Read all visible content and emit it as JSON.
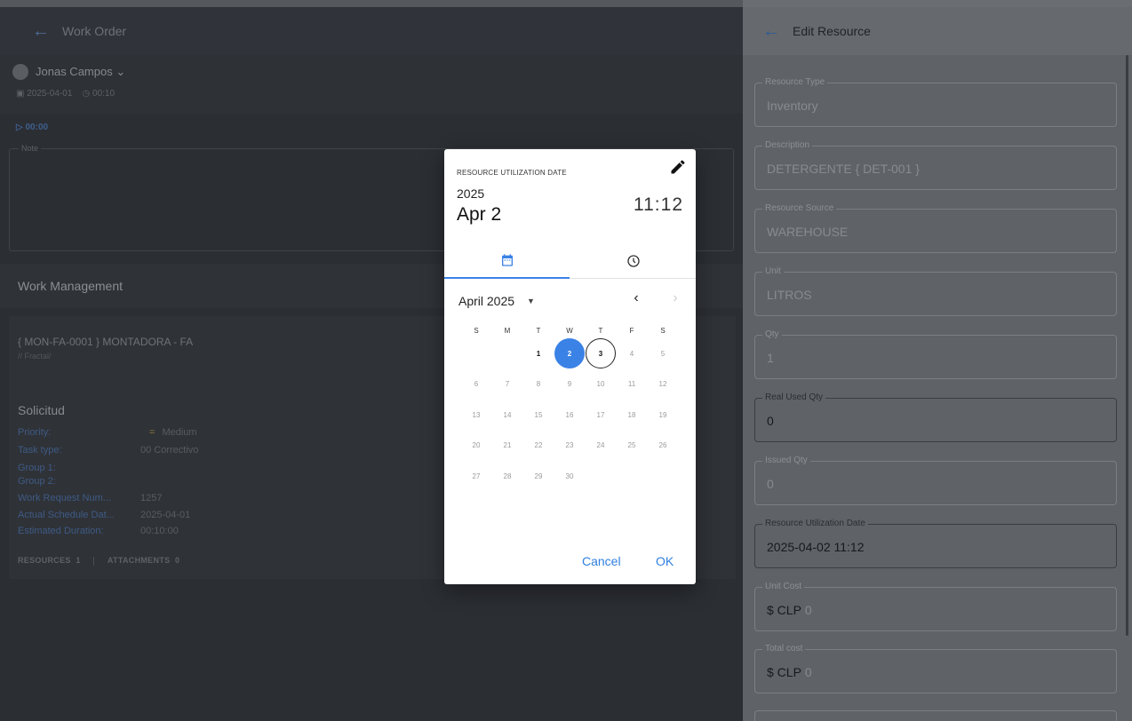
{
  "left": {
    "header_title": "Work Order",
    "user_name": "Jonas Campos",
    "date": "2025-04-01",
    "duration": "00:10",
    "timer": "00:00",
    "note_label": "Note",
    "section_title": "Work Management",
    "asset_title": "{ MON-FA-0001 } MONTADORA - FA",
    "asset_path": "// Fractal/",
    "request_title": "Solicitud",
    "fields": [
      {
        "label": "Priority:",
        "value": "Medium"
      },
      {
        "label": "Task type:",
        "value": "00 Correctivo"
      },
      {
        "label": "Group 1:",
        "value": ""
      },
      {
        "label": "Group 2:",
        "value": ""
      },
      {
        "label": "Work Request Num...",
        "value": "1257"
      },
      {
        "label": "Actual Schedule Dat...",
        "value": "2025-04-01"
      },
      {
        "label": "Estimated Duration:",
        "value": "00:10:00"
      }
    ],
    "tab_resources": "RESOURCES",
    "tab_resources_count": "1",
    "tab_attachments": "ATTACHMENTS",
    "tab_attachments_count": "0"
  },
  "right": {
    "title": "Edit Resource",
    "fields": [
      {
        "label": "Resource Type",
        "value": "Inventory"
      },
      {
        "label": "Description",
        "value": "DETERGENTE { DET-001 }"
      },
      {
        "label": "Resource Source",
        "value": "WAREHOUSE"
      },
      {
        "label": "Unit",
        "value": "LITROS"
      },
      {
        "label": "Qty",
        "value": "1"
      },
      {
        "label": "Real Used Qty",
        "value": "0"
      },
      {
        "label": "Issued Qty",
        "value": "0"
      },
      {
        "label": "Resource Utilization Date",
        "value": "2025-04-02 11:12"
      },
      {
        "label": "Unit Cost",
        "currency": "$ CLP",
        "value": "0"
      },
      {
        "label": "Total cost",
        "currency": "$ CLP",
        "value": "0"
      }
    ]
  },
  "dialog": {
    "label": "RESOURCE UTILIZATION DATE",
    "year": "2025",
    "date": "Apr 2",
    "time": "11:12",
    "month_label": "April 2025",
    "weekdays": [
      "S",
      "M",
      "T",
      "W",
      "T",
      "F",
      "S"
    ],
    "selected_day": 2,
    "today_day": 3,
    "cancel": "Cancel",
    "ok": "OK",
    "colors": {
      "accent": "#3b82e6",
      "action": "#2f7fe0"
    }
  }
}
